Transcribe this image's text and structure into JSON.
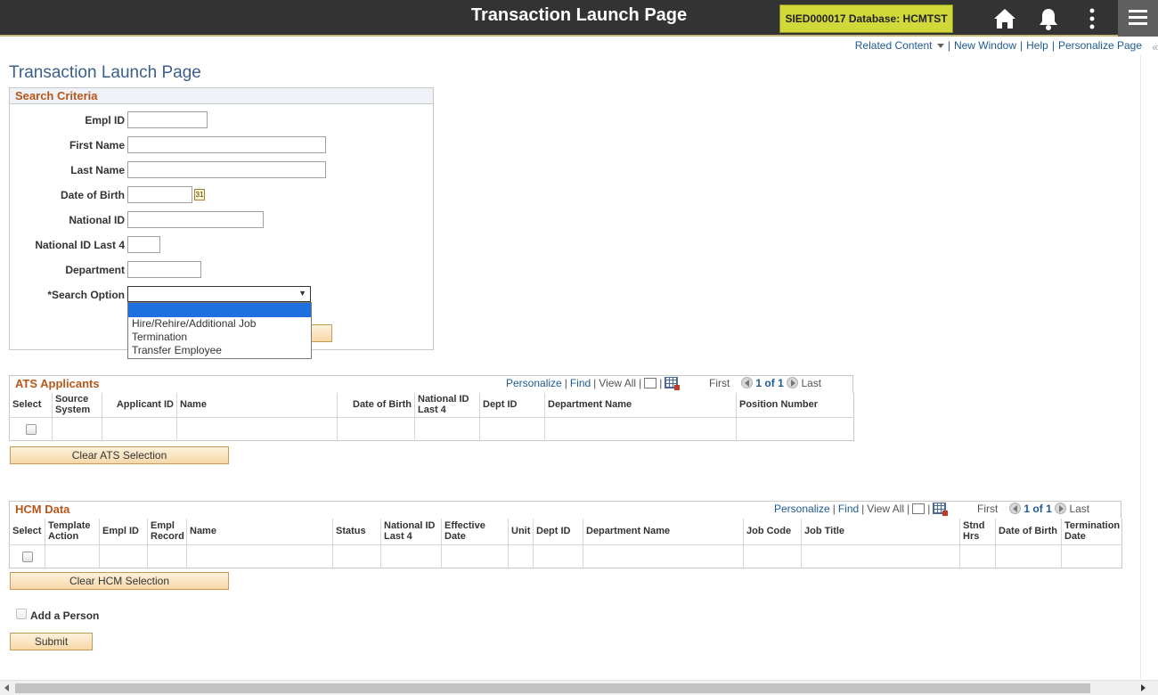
{
  "header": {
    "title": "Transaction Launch Page",
    "environment": "SIED000017 Database: HCMTST",
    "icons": [
      "home-icon",
      "bell-icon",
      "kebab-menu-icon",
      "nav-menu-icon"
    ]
  },
  "related_links": {
    "related_content": "Related Content",
    "new_window": "New Window",
    "help": "Help",
    "personalize_page": "Personalize Page",
    "collapse": "«"
  },
  "page_title": "Transaction Launch Page",
  "search_criteria": {
    "title": "Search Criteria",
    "fields": {
      "empl_id": {
        "label": "Empl ID",
        "value": ""
      },
      "first_name": {
        "label": "First Name",
        "value": ""
      },
      "last_name": {
        "label": "Last Name",
        "value": ""
      },
      "date_of_birth": {
        "label": "Date of Birth",
        "value": "",
        "calendar_glyph": "31"
      },
      "national_id": {
        "label": "National ID",
        "value": ""
      },
      "national_id_last4": {
        "label": "National ID Last 4",
        "value": ""
      },
      "department": {
        "label": "Department",
        "value": ""
      }
    },
    "search_option": {
      "required_mark": "*",
      "label": "Search Option",
      "value": "",
      "arrow": "▼",
      "options": [
        "",
        "Hire/Rehire/Additional Job",
        "Termination",
        "Transfer Employee"
      ]
    }
  },
  "ats": {
    "title": "ATS Applicants",
    "nav": {
      "personalize": "Personalize",
      "find": "Find",
      "view_all": "View All",
      "sep": "|",
      "first": "First",
      "range": "1 of 1",
      "last": "Last"
    },
    "columns": [
      "Select",
      "Source System",
      "Applicant ID",
      "Name",
      "Date of Birth",
      "National ID Last 4",
      "Dept ID",
      "Department Name",
      "Position Number"
    ],
    "clear_button": "Clear ATS Selection"
  },
  "hcm": {
    "title": "HCM Data",
    "nav": {
      "personalize": "Personalize",
      "find": "Find",
      "view_all": "View All",
      "sep": "|",
      "first": "First",
      "range": "1 of 1",
      "last": "Last"
    },
    "columns": [
      "Select",
      "Template Action",
      "Empl ID",
      "Empl Record",
      "Name",
      "Status",
      "National ID Last 4",
      "Effective Date",
      "Unit",
      "Dept ID",
      "Department Name",
      "Job Code",
      "Job Title",
      "Stnd Hrs",
      "Date of Birth",
      "Termination Date"
    ],
    "clear_button": "Clear HCM Selection"
  },
  "add_person": {
    "label": "Add a Person",
    "checked": false
  },
  "submit_label": "Submit",
  "colors": {
    "banner": "#333333",
    "env_badge": "#d1d83a",
    "section_title": "#b8561a",
    "link": "#1f5a93",
    "dropdown_highlight": "#1e6fe0",
    "button": "#f7d8a8"
  }
}
